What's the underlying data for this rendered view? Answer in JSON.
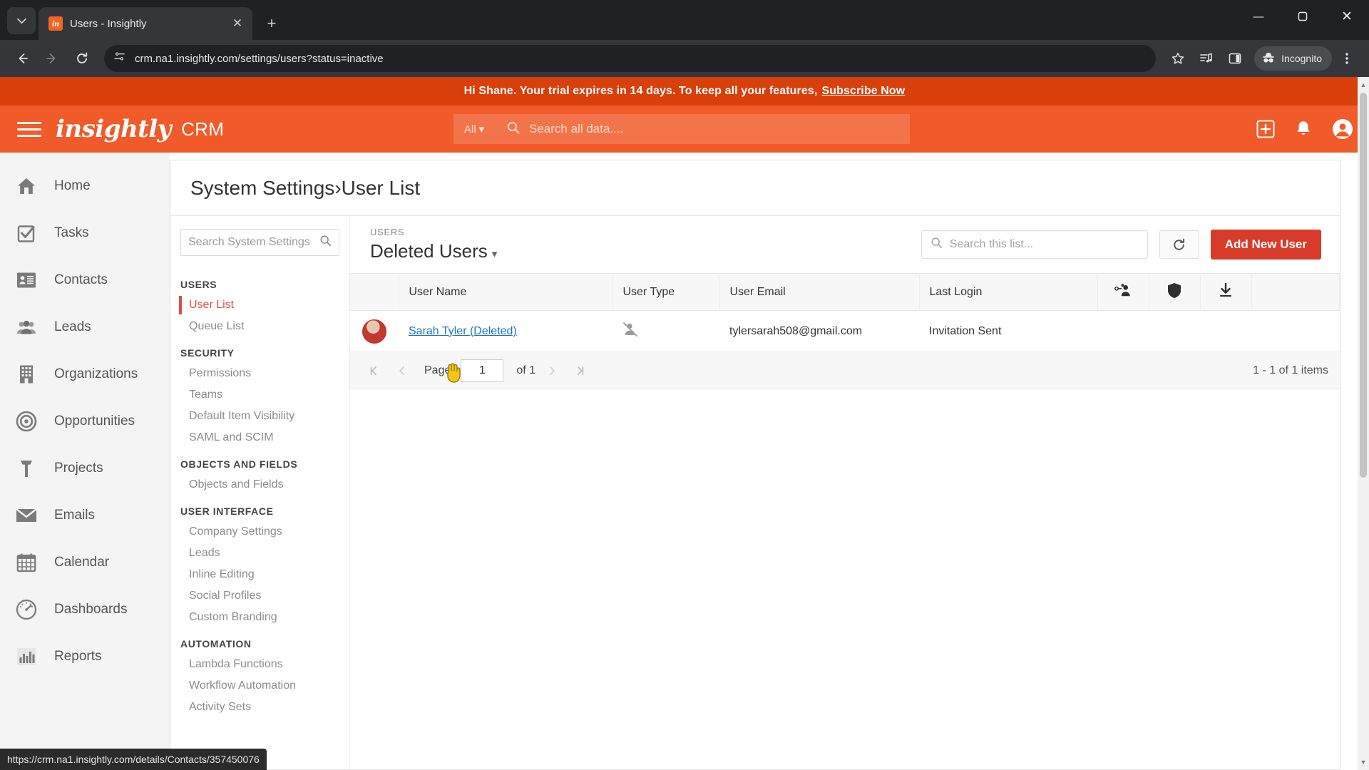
{
  "browser": {
    "tab": {
      "title": "Users - Insightly",
      "favicon_label": "in"
    },
    "new_tab_label": "+",
    "tab_search_icon": "chevron-down-icon",
    "window_controls": {
      "minimize": "—",
      "maximize": "❐",
      "close": "✕"
    },
    "nav": {
      "back": "←",
      "forward": "→",
      "reload": "↻"
    },
    "omnibox": {
      "url": "crm.na1.insightly.com/settings/users?status=inactive",
      "site_info_icon": "page-info-icon"
    },
    "actions": {
      "bookmark_icon": "star-icon",
      "media_icon": "media-control-icon",
      "split_icon": "side-panel-icon",
      "menu_icon": "three-dot-menu-icon",
      "incognito_label": "Incognito"
    }
  },
  "status_bar": {
    "url": "https://crm.na1.insightly.com/details/Contacts/357450076"
  },
  "trial_banner": {
    "message": "Hi Shane. Your trial expires in 14 days. To keep all your features,",
    "cta": "Subscribe Now"
  },
  "app_header": {
    "menu_icon": "hamburger-icon",
    "brand": "insightly",
    "product": "CRM",
    "search": {
      "scope": "All",
      "placeholder": "Search all data...."
    },
    "add_icon": "add-plus-icon",
    "notifications_icon": "bell-icon",
    "account_icon": "user-avatar-icon"
  },
  "left_nav": {
    "items": [
      {
        "label": "Home",
        "icon": "home-icon"
      },
      {
        "label": "Tasks",
        "icon": "checkbox-icon"
      },
      {
        "label": "Contacts",
        "icon": "contact-card-icon"
      },
      {
        "label": "Leads",
        "icon": "people-icon"
      },
      {
        "label": "Organizations",
        "icon": "building-icon"
      },
      {
        "label": "Opportunities",
        "icon": "target-icon"
      },
      {
        "label": "Projects",
        "icon": "hammer-icon"
      },
      {
        "label": "Emails",
        "icon": "envelope-icon"
      },
      {
        "label": "Calendar",
        "icon": "calendar-icon"
      },
      {
        "label": "Dashboards",
        "icon": "gauge-icon"
      },
      {
        "label": "Reports",
        "icon": "bar-chart-icon"
      }
    ]
  },
  "breadcrumb": {
    "root": "System Settings",
    "separator": "›",
    "current": "User List"
  },
  "settings_nav": {
    "search_placeholder": "Search System Settings",
    "search_icon": "search-icon",
    "groups": [
      {
        "title": "USERS",
        "items": [
          {
            "label": "User List",
            "active": true
          },
          {
            "label": "Queue List",
            "active": false
          }
        ]
      },
      {
        "title": "SECURITY",
        "items": [
          {
            "label": "Permissions",
            "active": false
          },
          {
            "label": "Teams",
            "active": false
          },
          {
            "label": "Default Item Visibility",
            "active": false
          },
          {
            "label": "SAML and SCIM",
            "active": false
          }
        ]
      },
      {
        "title": "OBJECTS AND FIELDS",
        "items": [
          {
            "label": "Objects and Fields",
            "active": false
          }
        ]
      },
      {
        "title": "USER INTERFACE",
        "items": [
          {
            "label": "Company Settings",
            "active": false
          },
          {
            "label": "Leads",
            "active": false
          },
          {
            "label": "Inline Editing",
            "active": false
          },
          {
            "label": "Social Profiles",
            "active": false
          },
          {
            "label": "Custom Branding",
            "active": false
          }
        ]
      },
      {
        "title": "AUTOMATION",
        "items": [
          {
            "label": "Lambda Functions",
            "active": false
          },
          {
            "label": "Workflow Automation",
            "active": false
          },
          {
            "label": "Activity Sets",
            "active": false
          }
        ]
      }
    ]
  },
  "user_list": {
    "eyebrow": "USERS",
    "title": "Deleted Users",
    "title_caret": "▾",
    "search_placeholder": "Search this list...",
    "search_icon": "search-icon",
    "refresh_icon": "refresh-icon",
    "add_button": "Add New User",
    "columns": [
      "User Name",
      "User Type",
      "User Email",
      "Last Login"
    ],
    "action_icons": [
      "manage-users-icon",
      "shield-icon",
      "download-icon"
    ],
    "rows": [
      {
        "avatar": "user-avatar",
        "name": "Sarah Tyler (Deleted)",
        "user_type_icon": "user-disabled-icon",
        "email": "tylersarah508@gmail.com",
        "last_login": "Invitation Sent"
      }
    ],
    "pager": {
      "first_icon": "first-page-icon",
      "prev_icon": "prev-page-icon",
      "page_label": "Page",
      "page_value": "1",
      "of_label": "of 1",
      "next_icon": "next-page-icon",
      "last_icon": "last-page-icon",
      "count": "1 - 1 of 1 items"
    }
  },
  "colors": {
    "brand_orange": "#f15a29",
    "banner_orange": "#d93f0b",
    "accent_red": "#d93b2b",
    "active_red": "#d94f45",
    "link_blue": "#1a73c7"
  }
}
